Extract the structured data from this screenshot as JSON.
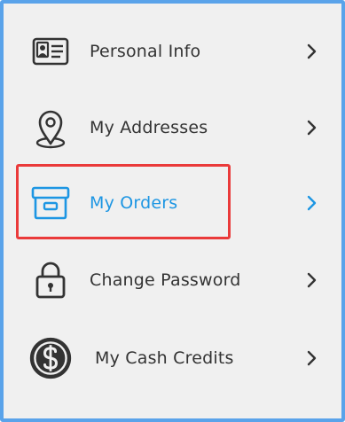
{
  "menu": {
    "items": [
      {
        "label": "Personal Info",
        "icon": "id-card-icon",
        "active": false
      },
      {
        "label": "My Addresses",
        "icon": "location-pin-icon",
        "active": false
      },
      {
        "label": "My Orders",
        "icon": "order-box-icon",
        "active": true
      },
      {
        "label": "Change Password",
        "icon": "padlock-icon",
        "active": false
      },
      {
        "label": "My Cash Credits",
        "icon": "dollar-coin-icon",
        "active": false
      }
    ]
  },
  "colors": {
    "frame_border": "#5aa3ea",
    "background": "#f0f0f0",
    "text": "#333333",
    "active": "#1d96e3",
    "highlight": "#ea3a3a"
  }
}
